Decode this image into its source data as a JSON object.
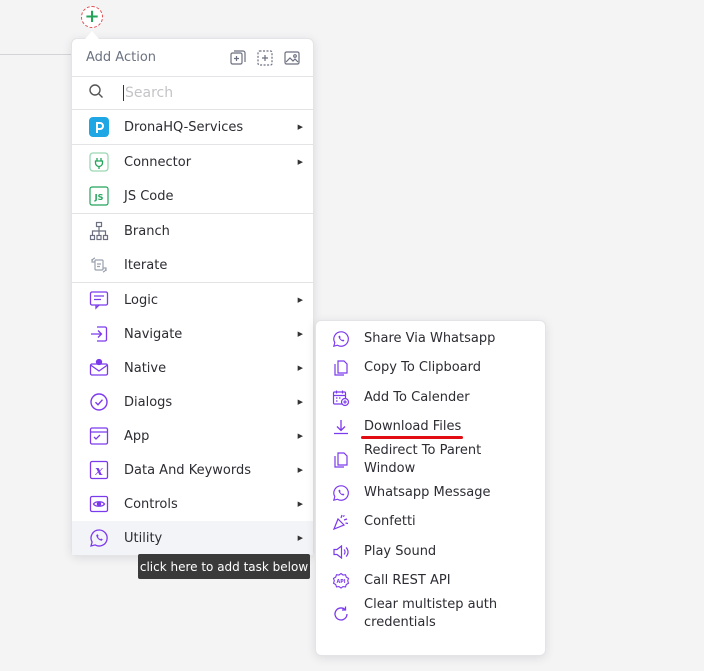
{
  "canvas": {
    "add_button_symbol": "+"
  },
  "panel": {
    "title": "Add Action",
    "search_placeholder": "Search",
    "header_icons": [
      "add-block-icon",
      "select-block-icon",
      "image-block-icon"
    ],
    "sections": [
      [
        {
          "label": "DronaHQ-Services",
          "icon": "dronahq-logo-icon",
          "has_submenu": true
        }
      ],
      [
        {
          "label": "Connector",
          "icon": "connector-plug-icon",
          "has_submenu": true
        },
        {
          "label": "JS Code",
          "icon": "js-icon",
          "has_submenu": false
        }
      ],
      [
        {
          "label": "Branch",
          "icon": "branch-icon",
          "has_submenu": false
        },
        {
          "label": "Iterate",
          "icon": "iterate-icon",
          "has_submenu": false
        }
      ],
      [
        {
          "label": "Logic",
          "icon": "logic-icon",
          "has_submenu": true
        },
        {
          "label": "Navigate",
          "icon": "navigate-icon",
          "has_submenu": true
        },
        {
          "label": "Native",
          "icon": "native-icon",
          "has_submenu": true
        },
        {
          "label": "Dialogs",
          "icon": "dialogs-icon",
          "has_submenu": true
        },
        {
          "label": "App",
          "icon": "app-icon",
          "has_submenu": true
        },
        {
          "label": "Data And Keywords",
          "icon": "data-keywords-icon",
          "has_submenu": true
        },
        {
          "label": "Controls",
          "icon": "controls-icon",
          "has_submenu": true
        },
        {
          "label": "Utility",
          "icon": "utility-icon",
          "has_submenu": true
        }
      ]
    ]
  },
  "tooltip": "click here to add task below",
  "submenu": {
    "items": [
      {
        "label": "Share Via Whatsapp",
        "icon": "whatsapp-icon"
      },
      {
        "label": "Copy To Clipboard",
        "icon": "copy-icon"
      },
      {
        "label": "Add To Calender",
        "icon": "calendar-add-icon"
      },
      {
        "label": "Download Files",
        "icon": "download-icon"
      },
      {
        "label": "Redirect To Parent Window",
        "icon": "redirect-icon"
      },
      {
        "label": "Whatsapp Message",
        "icon": "whatsapp-icon"
      },
      {
        "label": "Confetti",
        "icon": "confetti-icon"
      },
      {
        "label": "Play Sound",
        "icon": "speaker-icon"
      },
      {
        "label": "Call REST API",
        "icon": "api-icon"
      },
      {
        "label": "Clear multistep auth credentials",
        "icon": "refresh-icon"
      }
    ]
  },
  "colors": {
    "icon": "#7c3aed",
    "dronahq": "#1ea7e4",
    "connector": "#22a55a",
    "highlight": "#e10d13"
  }
}
